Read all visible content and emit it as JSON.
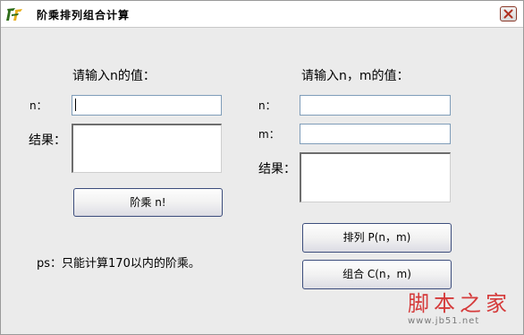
{
  "window": {
    "title": "阶乘排列组合计算",
    "close_symbol": "×"
  },
  "left": {
    "heading": "请输入n的值：",
    "n_label": "n：",
    "n_value": "",
    "result_label": "结果：",
    "result_value": "",
    "button_label": "阶乘 n!",
    "note": "ps：只能计算170以内的阶乘。"
  },
  "right": {
    "heading": "请输入n，m的值：",
    "n_label": "n：",
    "n_value": "",
    "m_label": "m：",
    "m_value": "",
    "result_label": "结果：",
    "result_value": "",
    "perm_button_label": "排列 P(n，m)",
    "comb_button_label": "组合 C(n，m)"
  },
  "watermark": {
    "main": "脚本之家",
    "url": "www.jb51.net"
  },
  "colors": {
    "window_bg": "#ebebeb",
    "watermark_red": "#d53a3a",
    "input_border": "#7f9db9",
    "button_border": "#3c4d7c"
  },
  "icons": {
    "app": "app-logo-icon",
    "close": "close-icon"
  }
}
